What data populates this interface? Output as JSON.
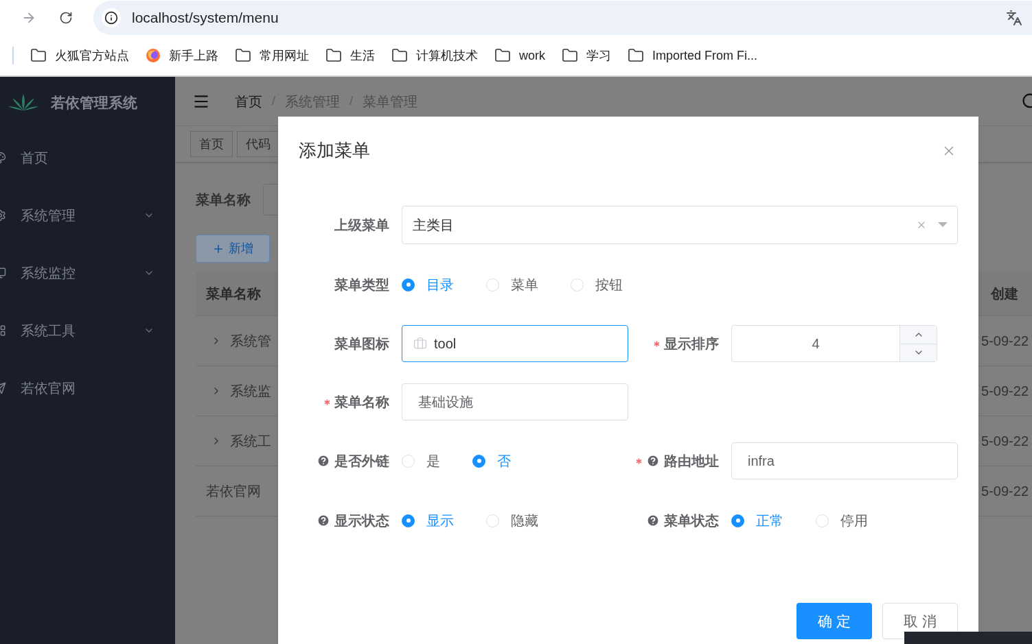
{
  "browser": {
    "url": "localhost/system/menu",
    "bookmarks": [
      {
        "kind": "folder",
        "label": "火狐官方站点"
      },
      {
        "kind": "firefox",
        "label": "新手上路"
      },
      {
        "kind": "folder",
        "label": "常用网址"
      },
      {
        "kind": "folder",
        "label": "生活"
      },
      {
        "kind": "folder",
        "label": "计算机技术"
      },
      {
        "kind": "folder",
        "label": "work"
      },
      {
        "kind": "folder",
        "label": "学习"
      },
      {
        "kind": "folder",
        "label": "Imported From Fi..."
      }
    ]
  },
  "sidebar": {
    "title": "若依管理系统",
    "items": [
      {
        "kind": "home",
        "label": "首页",
        "expandable": false
      },
      {
        "kind": "system",
        "label": "系统管理",
        "expandable": true
      },
      {
        "kind": "monitor",
        "label": "系统监控",
        "expandable": true
      },
      {
        "kind": "tool",
        "label": "系统工具",
        "expandable": true
      },
      {
        "kind": "link",
        "label": "若依官网",
        "expandable": false
      }
    ]
  },
  "header": {
    "breadcrumb": [
      {
        "label": "首页"
      },
      {
        "separator": "/",
        "label": "系统管理"
      },
      {
        "separator": "/",
        "label": "菜单管理"
      }
    ]
  },
  "tags": [
    "首页",
    "代码"
  ],
  "search": {
    "label": "菜单名称"
  },
  "add_button": "新增",
  "table": {
    "columns": [
      "菜单名称",
      "创建"
    ],
    "rows": [
      {
        "name": "系统管",
        "expandable": true,
        "created": "5-09-22"
      },
      {
        "name": "系统监",
        "expandable": true,
        "created": "5-09-22"
      },
      {
        "name": "系统工",
        "expandable": true,
        "created": "5-09-22"
      },
      {
        "name": "若依官网",
        "expandable": false,
        "created": "5-09-22"
      }
    ]
  },
  "dialog": {
    "title": "添加菜单",
    "rows": [
      [
        {
          "kind": "select",
          "label": "上级菜单",
          "value": "主类目",
          "required": false,
          "help": false
        }
      ],
      [
        {
          "kind": "radio",
          "label": "菜单类型",
          "required": false,
          "help": false,
          "options": [
            {
              "label": "目录",
              "selected": true
            },
            {
              "label": "菜单",
              "selected": false
            },
            {
              "label": "按钮",
              "selected": false
            }
          ]
        }
      ],
      [
        {
          "kind": "icon-input",
          "label": "菜单图标",
          "value": "tool",
          "focused": true,
          "required": false,
          "help": false
        },
        {
          "kind": "number",
          "label": "显示排序",
          "value": "4",
          "required": true,
          "help": false
        }
      ],
      [
        {
          "kind": "text",
          "label": "菜单名称",
          "value": "基础设施",
          "required": true,
          "help": false
        }
      ],
      [
        {
          "kind": "radio",
          "label": "是否外链",
          "required": false,
          "help": true,
          "options": [
            {
              "label": "是",
              "selected": false
            },
            {
              "label": "否",
              "selected": true
            }
          ]
        },
        {
          "kind": "text",
          "label": "路由地址",
          "value": "infra",
          "required": true,
          "help": true
        }
      ],
      [
        {
          "kind": "radio",
          "label": "显示状态",
          "required": false,
          "help": true,
          "options": [
            {
              "label": "显示",
              "selected": true
            },
            {
              "label": "隐藏",
              "selected": false
            }
          ]
        },
        {
          "kind": "radio",
          "label": "菜单状态",
          "required": false,
          "help": true,
          "options": [
            {
              "label": "正常",
              "selected": true
            },
            {
              "label": "停用",
              "selected": false
            }
          ]
        }
      ]
    ],
    "buttons": [
      {
        "kind": "primary",
        "label": "确 定"
      },
      {
        "kind": "default",
        "label": "取 消"
      }
    ]
  }
}
